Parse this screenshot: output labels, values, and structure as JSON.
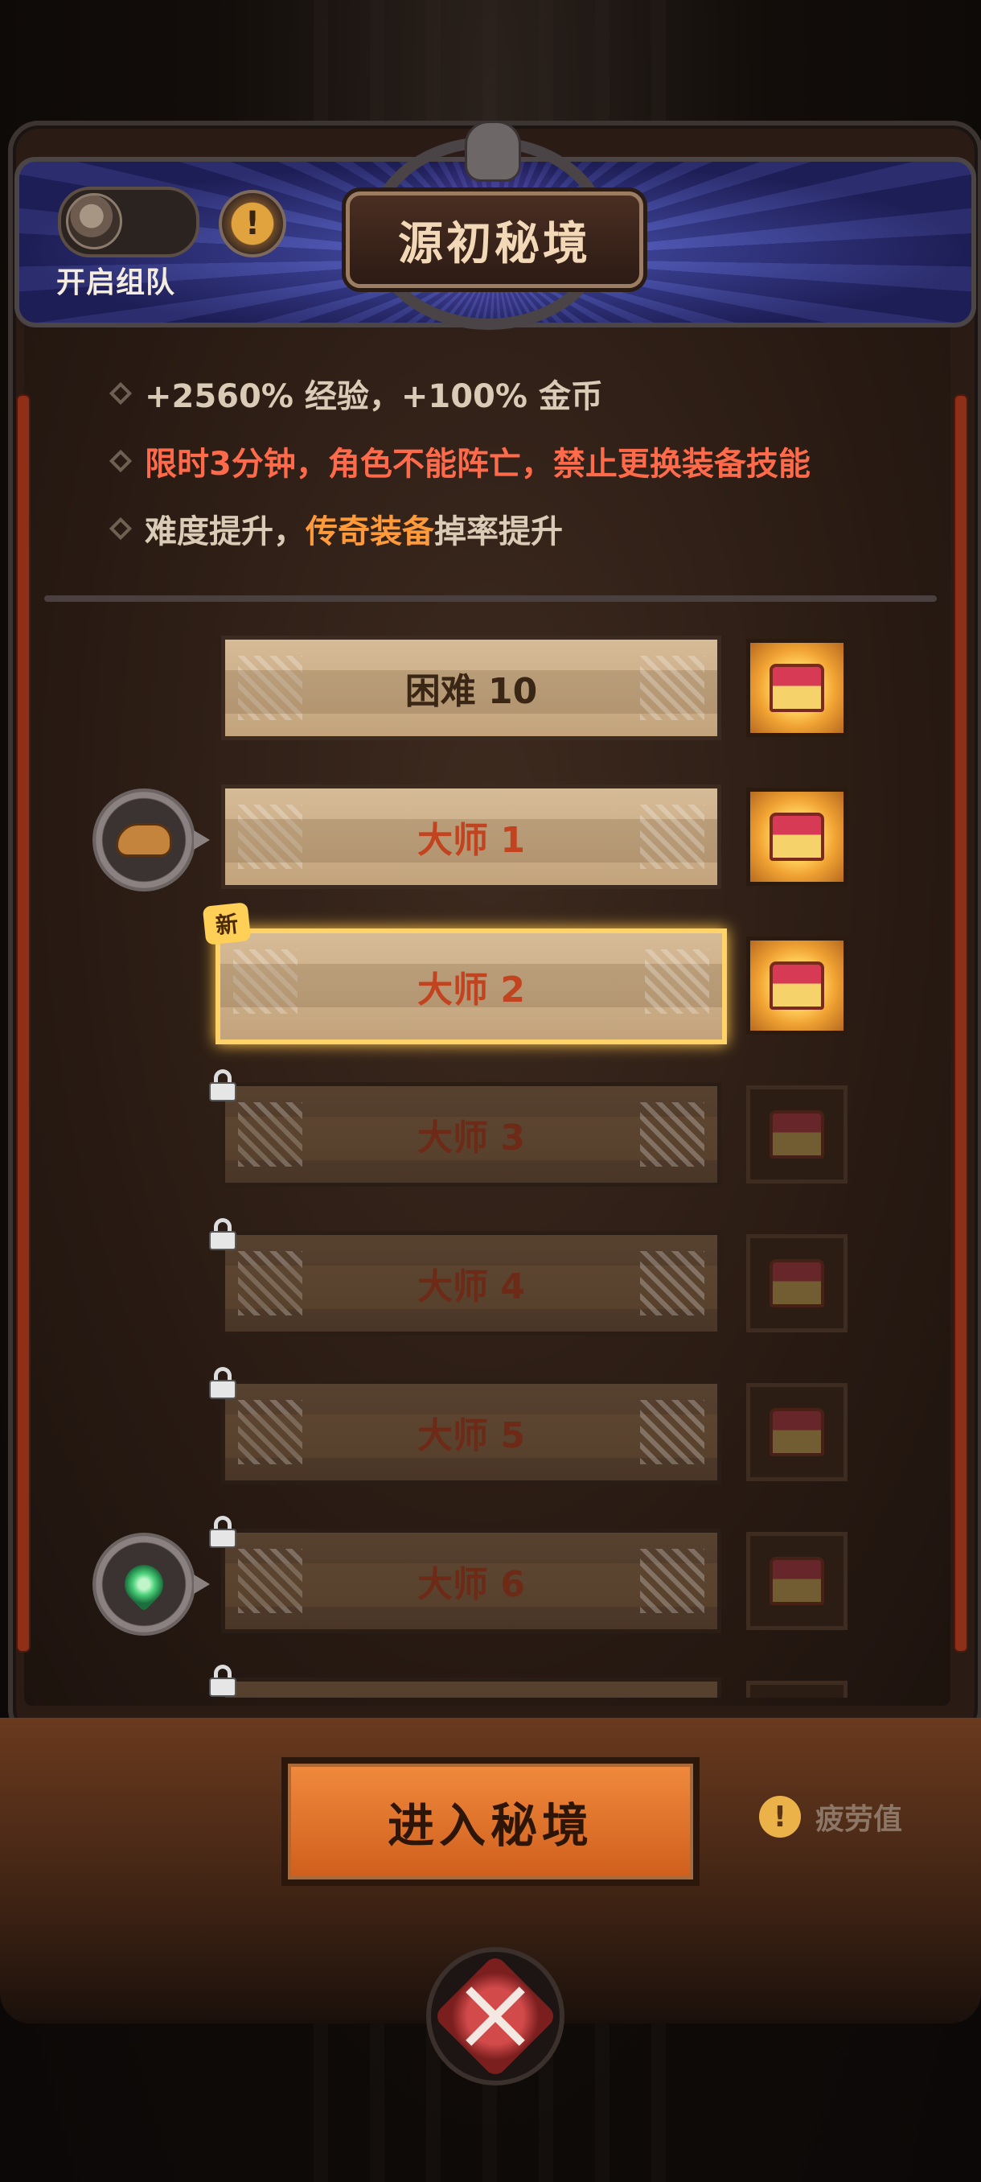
{
  "header": {
    "title": "源初秘境",
    "team_toggle_label": "开启组队",
    "info_glyph": "!"
  },
  "description": {
    "line1": "+2560% 经验，+100% 金币",
    "line2": "限时3分钟，角色不能阵亡，禁止更换装备技能",
    "line3_prefix": "难度提升，",
    "line3_highlight": "传奇装备",
    "line3_suffix": " 掉率提升"
  },
  "levels": [
    {
      "label": "困难 10",
      "state": "unlocked",
      "style": "normal",
      "chest": "open"
    },
    {
      "label": "大师 1",
      "state": "unlocked",
      "style": "master",
      "chest": "open",
      "side_icon": "hand-icon"
    },
    {
      "label": "大师 2",
      "state": "selected",
      "style": "master",
      "chest": "open",
      "badge": "新"
    },
    {
      "label": "大师 3",
      "state": "locked",
      "style": "master",
      "chest": "locked"
    },
    {
      "label": "大师 4",
      "state": "locked",
      "style": "master",
      "chest": "locked"
    },
    {
      "label": "大师 5",
      "state": "locked",
      "style": "master",
      "chest": "locked"
    },
    {
      "label": "大师 6",
      "state": "locked",
      "style": "master",
      "chest": "locked",
      "side_icon": "leaf-icon"
    }
  ],
  "footer": {
    "enter_button": "进入秘境",
    "fatigue_label": "疲劳值",
    "fatigue_glyph": "!"
  },
  "colors": {
    "accent_orange": "#ff9a3b",
    "warning_red": "#ff6a4a",
    "selected_border": "#ffd36a"
  }
}
